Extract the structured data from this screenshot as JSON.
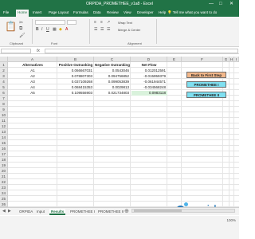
{
  "window": {
    "title": "ORPIDA_PROMETHEE_v1a8 - Excel",
    "controls": [
      "—",
      "□",
      "✕"
    ]
  },
  "menu": {
    "items": [
      "File",
      "Home",
      "Insert",
      "Page Layout",
      "Formulas",
      "Data",
      "Review",
      "View",
      "Developer",
      "Help"
    ],
    "active": "Home",
    "tell_me": "Tell me what you want to do"
  },
  "ribbon": {
    "groups": [
      {
        "label": "Clipboard"
      },
      {
        "label": "Font"
      },
      {
        "label": "Alignment"
      }
    ],
    "font_name": "",
    "wrap_text": "Wrap Text",
    "merge_center": "Merge & Center"
  },
  "formula_bar": {
    "fx": "fx",
    "name_box": "",
    "content": ""
  },
  "grid": {
    "columns": [
      "A",
      "B",
      "C",
      "D",
      "E",
      "F",
      "G",
      "H",
      "I"
    ],
    "rows": [
      "1",
      "2",
      "3",
      "4",
      "5",
      "6",
      "7",
      "8",
      "9",
      "10",
      "11",
      "12",
      "13",
      "14",
      "15",
      "16",
      "17",
      "18",
      "19",
      "20",
      "21",
      "22",
      "23",
      "24",
      "25",
      "26",
      "27"
    ],
    "table": {
      "headers": [
        "Alternatives",
        "Positive Outranking",
        "Negative Outranking",
        "Net Flow"
      ],
      "rows": [
        [
          "A1",
          "0.066667031",
          "0.0543046",
          "0.012012591"
        ],
        [
          "A2",
          "0.078807303",
          "0.094756852",
          "-0.015959379"
        ],
        [
          "A3",
          "0.037109268",
          "0.099053839",
          "-0.061944571"
        ],
        [
          "A4",
          "0.068415353",
          "0.0029813",
          "-0.034568248"
        ],
        [
          "A5",
          "0.109556903",
          "0.021734803",
          "0.0983118"
        ]
      ]
    },
    "highlight_color": "#d9f2dc"
  },
  "side_buttons": [
    {
      "label": "Back to First Step",
      "color": "#f2b78a"
    },
    {
      "label": "PROMETHEE I",
      "color": "#7fdff0"
    },
    {
      "label": "PROMETHEE II",
      "color": "#7fdff0"
    }
  ],
  "logo": {
    "text": "orpida",
    "colors": [
      "#2a7ab8",
      "#4fb3e8"
    ]
  },
  "sheet_tabs": {
    "items": [
      "ORPIDA",
      "Input",
      "Results",
      "PROMETHEE I",
      "PROMETHEE II"
    ],
    "active": "Results"
  },
  "status": {
    "ready": "",
    "zoom": "100%"
  }
}
